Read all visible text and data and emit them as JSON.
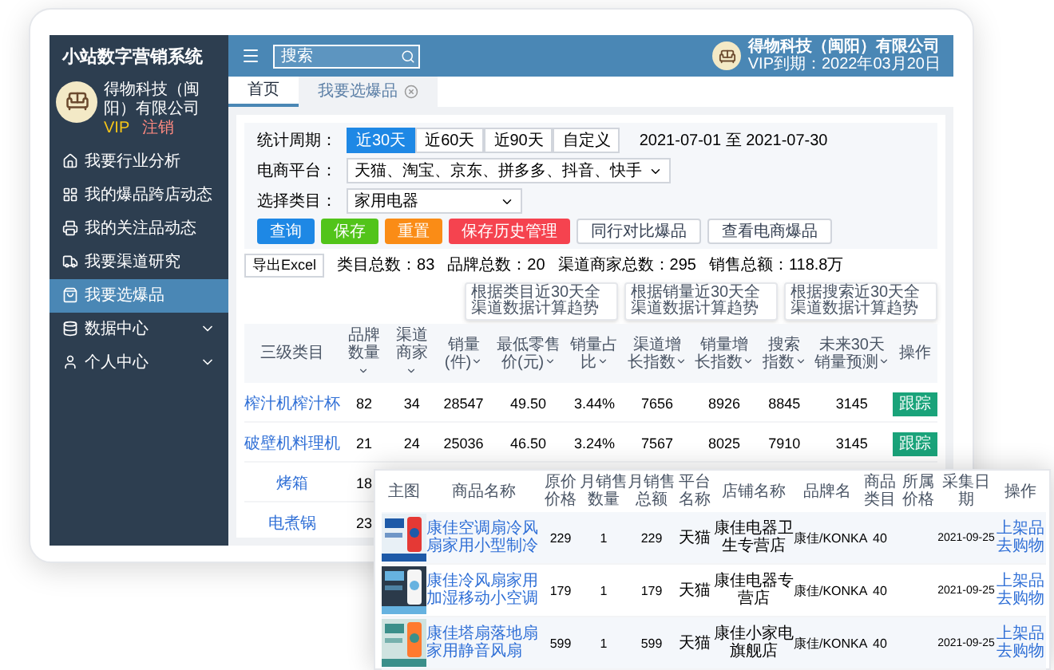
{
  "app": {
    "title": "小站数字营销系统"
  },
  "profile": {
    "company": "得物科技（闽阳）有限公司",
    "vip": "VIP",
    "logout": "注销"
  },
  "sidebar": {
    "items": [
      {
        "label": "我要行业分析",
        "kind": "link",
        "selected": false
      },
      {
        "label": "我的爆品跨店动态",
        "kind": "link",
        "selected": false
      },
      {
        "label": "我的关注品动态",
        "kind": "link",
        "selected": false
      },
      {
        "label": "我要渠道研究",
        "kind": "link",
        "selected": false
      },
      {
        "label": "我要选爆品",
        "kind": "link",
        "selected": true
      },
      {
        "label": "数据中心",
        "kind": "group",
        "selected": false
      },
      {
        "label": "个人中心",
        "kind": "group",
        "selected": false
      }
    ]
  },
  "topbar": {
    "search": {
      "placeholder": "搜索"
    },
    "user": {
      "company": "得物科技（闽阳）有限公司",
      "expiry": "VIP到期：2022年03月20日"
    }
  },
  "tabs": [
    {
      "label": "首页",
      "selected": true,
      "closable": false
    },
    {
      "label": "我要选爆品",
      "selected": false,
      "closable": true
    }
  ],
  "filters": {
    "period": {
      "label": "统计周期：",
      "options": [
        {
          "label": "近30天",
          "selected": true
        },
        {
          "label": "近60天",
          "selected": false
        },
        {
          "label": "近90天",
          "selected": false
        },
        {
          "label": "自定义",
          "selected": false
        }
      ],
      "range": "2021-07-01 至 2021-07-30"
    },
    "platform": {
      "label": "电商平台：",
      "value": "天猫、淘宝、京东、拼多多、抖音、快手"
    },
    "category": {
      "label": "选择类目：",
      "value": "家用电器"
    },
    "buttons": [
      {
        "label": "查询",
        "kind": "primary"
      },
      {
        "label": "保存",
        "kind": "success"
      },
      {
        "label": "重置",
        "kind": "warning"
      },
      {
        "label": "保存历史管理",
        "kind": "danger"
      },
      {
        "label": "同行对比爆品",
        "kind": "default"
      },
      {
        "label": "查看电商爆品",
        "kind": "default"
      }
    ]
  },
  "summary": {
    "export": "导出Excel",
    "stats": [
      "类目总数：83",
      "品牌总数：20",
      "渠道商家总数：295",
      "销售总额：118.8万"
    ]
  },
  "tooltips": [
    "根据类目近30天全渠道数据计算趋势",
    "根据销量近30天全渠道数据计算趋势",
    "根据搜索近30天全渠道数据计算趋势"
  ],
  "table": {
    "columns": [
      {
        "label": "三级类目",
        "sortable": false
      },
      {
        "label": "品牌数量",
        "sortable": true
      },
      {
        "label": "渠道商家",
        "sortable": true
      },
      {
        "label": "销量(件)",
        "sortable": true
      },
      {
        "label": "最低零售价(元)",
        "sortable": true
      },
      {
        "label": "销量占比",
        "sortable": true
      },
      {
        "label": "渠道增长指数",
        "sortable": true
      },
      {
        "label": "销量增长指数",
        "sortable": true
      },
      {
        "label": "搜索指数",
        "sortable": true
      },
      {
        "label": "未来30天销量预测",
        "sortable": true
      },
      {
        "label": "操作",
        "sortable": false
      }
    ],
    "rows": [
      {
        "cells": [
          "榨汁机榨汁杯",
          "82",
          "34",
          "28547",
          "49.50",
          "3.44%",
          "7656",
          "8926",
          "8845",
          "3145"
        ],
        "action": "跟踪"
      },
      {
        "cells": [
          "破壁机料理机",
          "21",
          "24",
          "25036",
          "46.50",
          "3.24%",
          "7567",
          "8025",
          "7910",
          "3145"
        ],
        "action": "跟踪"
      },
      {
        "cells": [
          "烤箱",
          "18"
        ]
      },
      {
        "cells": [
          "电煮锅",
          "23"
        ]
      }
    ]
  },
  "products": {
    "columns": [
      "主图",
      "商品名称",
      "原价价格",
      "月销售数量",
      "月销售总额",
      "平台名称",
      "店铺名称",
      "品牌名",
      "商品类目",
      "所属价格",
      "采集日期",
      "操作"
    ],
    "rows": [
      {
        "name": "康佳空调扇冷风扇家用小型制冷",
        "price": "229",
        "quantity": "1",
        "total": "229",
        "platform": "天猫",
        "shop": "康佳电器卫生专营店",
        "brand": "康佳/KONKA",
        "category": "40",
        "date": "2021-09-25",
        "actions": [
          "上架品",
          "去购物"
        ]
      },
      {
        "name": "康佳冷风扇家用加湿移动小空调",
        "price": "179",
        "quantity": "1",
        "total": "179",
        "platform": "天猫",
        "shop": "康佳电器专营店",
        "brand": "康佳/KONKA",
        "category": "40",
        "date": "2021-09-25",
        "actions": [
          "上架品",
          "去购物"
        ]
      },
      {
        "name": "康佳塔扇落地扇家用静音风扇",
        "price": "599",
        "quantity": "1",
        "total": "599",
        "platform": "天猫",
        "shop": "康佳小家电旗舰店",
        "brand": "康佳/KONKA",
        "category": "40",
        "date": "2021-09-25",
        "actions": [
          "上架品",
          "去购物"
        ]
      }
    ]
  }
}
